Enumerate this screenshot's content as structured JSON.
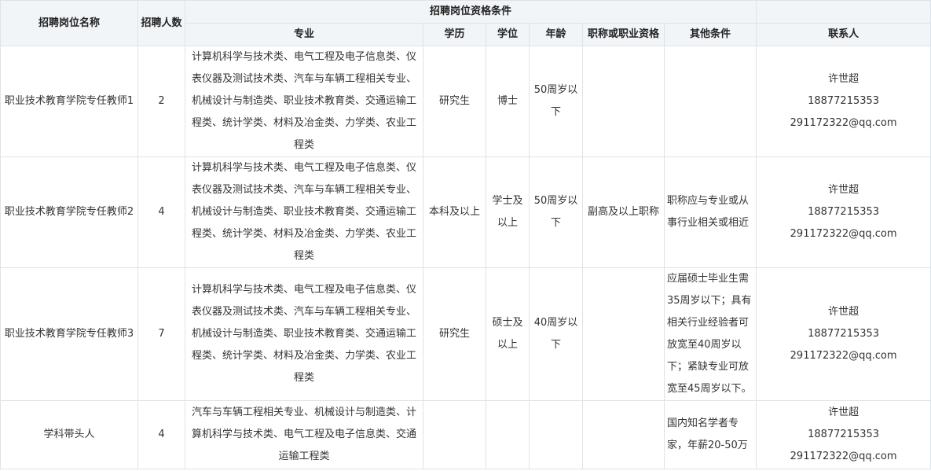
{
  "headers": {
    "position_name": "招聘岗位名称",
    "count": "招聘人数",
    "qualifications_group": "招聘岗位资格条件",
    "contact_group": "",
    "major": "专业",
    "education": "学历",
    "degree": "学位",
    "age": "年龄",
    "title": "职称或职业资格",
    "other": "其他条件",
    "contact": "联系人"
  },
  "rows": [
    {
      "name": "职业技术教育学院专任教师1",
      "count": "2",
      "major": "计算机科学与技术类、电气工程及电子信息类、仪表仪器及测试技术类、汽车与车辆工程相关专业、机械设计与制造类、职业技术教育类、交通运输工程类、统计学类、材料及冶金类、力学类、农业工程类",
      "education": "研究生",
      "degree": "博士",
      "age": "50周岁以下",
      "title": "",
      "other": "",
      "contact_name": "许世超",
      "contact_phone": "18877215353",
      "contact_email": "291172322@qq.com"
    },
    {
      "name": "职业技术教育学院专任教师2",
      "count": "4",
      "major": "计算机科学与技术类、电气工程及电子信息类、仪表仪器及测试技术类、汽车与车辆工程相关专业、机械设计与制造类、职业技术教育类、交通运输工程类、统计学类、材料及冶金类、力学类、农业工程类",
      "education": "本科及以上",
      "degree": "学士及以上",
      "age": "50周岁以下",
      "title": "副高及以上职称",
      "other": "职称应与专业或从事行业相关或相近",
      "contact_name": "许世超",
      "contact_phone": "18877215353",
      "contact_email": "291172322@qq.com"
    },
    {
      "name": "职业技术教育学院专任教师3",
      "count": "7",
      "major": "计算机科学与技术类、电气工程及电子信息类、仪表仪器及测试技术类、汽车与车辆工程相关专业、机械设计与制造类、职业技术教育类、交通运输工程类、统计学类、材料及冶金类、力学类、农业工程类",
      "education": "研究生",
      "degree": "硕士及以上",
      "age": "40周岁以下",
      "title": "",
      "other": "应届硕士毕业生需35周岁以下；具有相关行业经验者可放宽至40周岁以下；紧缺专业可放宽至45周岁以下。",
      "contact_name": "许世超",
      "contact_phone": "18877215353",
      "contact_email": "291172322@qq.com"
    },
    {
      "name": "学科带头人",
      "count": "4",
      "major": "汽车与车辆工程相关专业、机械设计与制造类、计算机科学与技术类、电气工程及电子信息类、交通运输工程类",
      "education": "",
      "degree": "",
      "age": "",
      "title": "",
      "other": "国内知名学者专家，年薪20-50万",
      "contact_name": "许世超",
      "contact_phone": "18877215353",
      "contact_email": "291172322@qq.com"
    }
  ]
}
